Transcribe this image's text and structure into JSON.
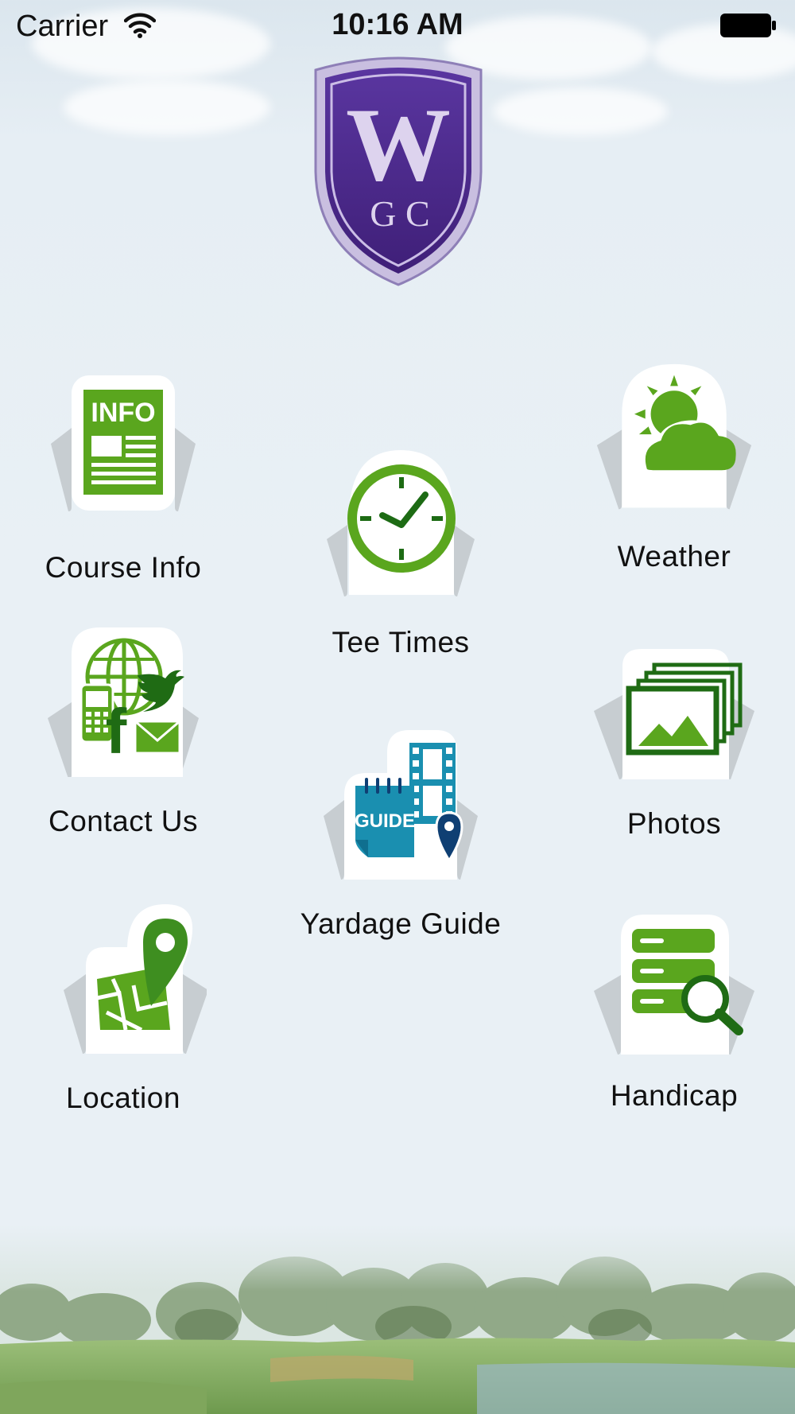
{
  "status": {
    "carrier": "Carrier",
    "time": "10:16 AM",
    "wifi_icon": "wifi-icon",
    "battery_icon": "battery-icon"
  },
  "logo": {
    "big_letter": "W",
    "sub_letters": "G C",
    "colors": {
      "primary": "#4b2a86",
      "light": "#d8cde8"
    }
  },
  "menu": {
    "course_info": {
      "label": "Course Info",
      "icon": "info-newspaper-icon",
      "badge": "INFO"
    },
    "weather": {
      "label": "Weather",
      "icon": "sun-cloud-icon"
    },
    "tee_times": {
      "label": "Tee Times",
      "icon": "clock-icon"
    },
    "contact_us": {
      "label": "Contact Us",
      "icon": "contact-social-icon"
    },
    "photos": {
      "label": "Photos",
      "icon": "photos-stack-icon"
    },
    "yardage_guide": {
      "label": "Yardage Guide",
      "icon": "guide-map-icon",
      "badge": "GUIDE"
    },
    "location": {
      "label": "Location",
      "icon": "map-pin-icon"
    },
    "handicap": {
      "label": "Handicap",
      "icon": "database-search-icon"
    }
  },
  "theme": {
    "accent_green": "#5aa61e",
    "guide_blue": "#1a8fb0",
    "pin_navy": "#0f3f73"
  }
}
